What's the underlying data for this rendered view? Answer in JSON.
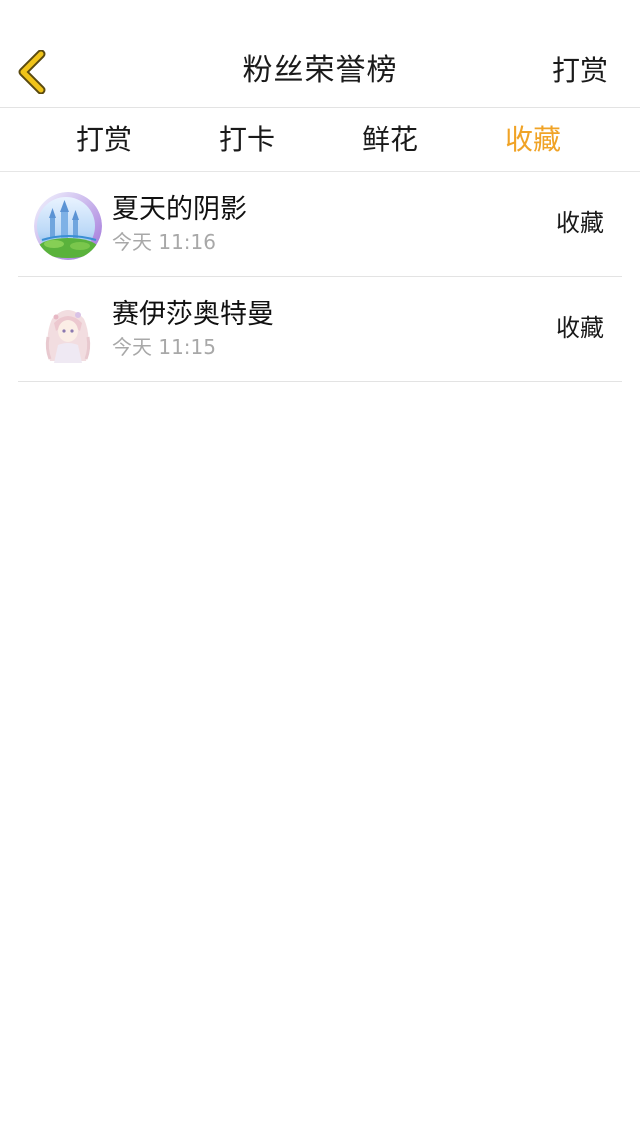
{
  "nav": {
    "title": "粉丝荣誉榜",
    "right_action": "打赏",
    "back_icon": "chevron-left-icon",
    "back_icon_color": "#f0c419"
  },
  "tabs": [
    {
      "label": "打赏",
      "active": false
    },
    {
      "label": "打卡",
      "active": false
    },
    {
      "label": "鲜花",
      "active": false
    },
    {
      "label": "收藏",
      "active": true
    }
  ],
  "colors": {
    "accent": "#f0a326",
    "text": "#1a1a1a",
    "muted": "#a8a8a8",
    "divider": "#e3e3e3"
  },
  "list": [
    {
      "name": "夏天的阴影",
      "time": "今天 11:16",
      "type": "收藏",
      "avatar": "castle-landscape-avatar"
    },
    {
      "name": "赛伊莎奥特曼",
      "time": "今天 11:15",
      "type": "收藏",
      "avatar": "anime-girl-avatar"
    }
  ]
}
